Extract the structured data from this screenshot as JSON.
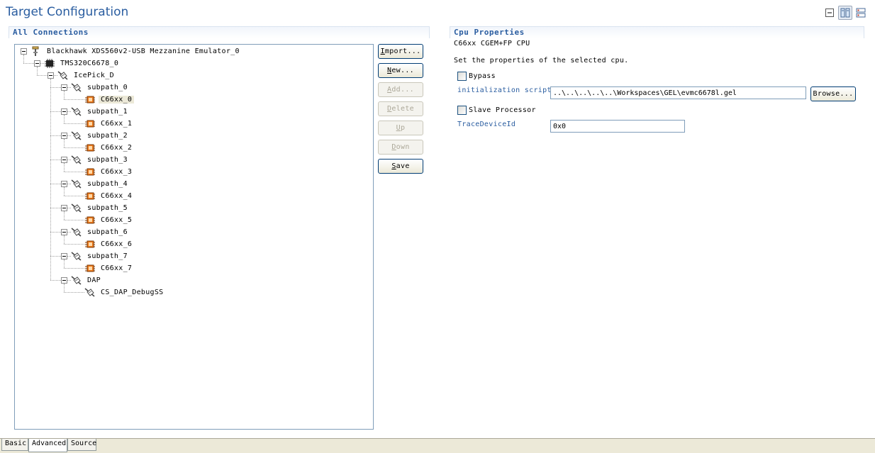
{
  "page": {
    "title": "Target Configuration"
  },
  "left_section": {
    "title": "All Connections"
  },
  "tree": [
    {
      "label": "Blackhawk XDS560v2-USB Mezzanine Emulator_0",
      "icon": "emulator-icon",
      "depth": 0,
      "expandable": true,
      "selected": false
    },
    {
      "label": "TMS320C6678_0",
      "icon": "chip-icon",
      "depth": 1,
      "expandable": true,
      "selected": false
    },
    {
      "label": "IcePick_D",
      "icon": "router-icon",
      "depth": 2,
      "expandable": true,
      "selected": false
    },
    {
      "label": "subpath_0",
      "icon": "router-icon",
      "depth": 3,
      "expandable": true,
      "selected": false
    },
    {
      "label": "C66xx_0",
      "icon": "cpu-icon",
      "depth": 4,
      "expandable": false,
      "selected": true
    },
    {
      "label": "subpath_1",
      "icon": "router-icon",
      "depth": 3,
      "expandable": true,
      "selected": false
    },
    {
      "label": "C66xx_1",
      "icon": "cpu-icon",
      "depth": 4,
      "expandable": false,
      "selected": false
    },
    {
      "label": "subpath_2",
      "icon": "router-icon",
      "depth": 3,
      "expandable": true,
      "selected": false
    },
    {
      "label": "C66xx_2",
      "icon": "cpu-icon",
      "depth": 4,
      "expandable": false,
      "selected": false
    },
    {
      "label": "subpath_3",
      "icon": "router-icon",
      "depth": 3,
      "expandable": true,
      "selected": false
    },
    {
      "label": "C66xx_3",
      "icon": "cpu-icon",
      "depth": 4,
      "expandable": false,
      "selected": false
    },
    {
      "label": "subpath_4",
      "icon": "router-icon",
      "depth": 3,
      "expandable": true,
      "selected": false
    },
    {
      "label": "C66xx_4",
      "icon": "cpu-icon",
      "depth": 4,
      "expandable": false,
      "selected": false
    },
    {
      "label": "subpath_5",
      "icon": "router-icon",
      "depth": 3,
      "expandable": true,
      "selected": false
    },
    {
      "label": "C66xx_5",
      "icon": "cpu-icon",
      "depth": 4,
      "expandable": false,
      "selected": false
    },
    {
      "label": "subpath_6",
      "icon": "router-icon",
      "depth": 3,
      "expandable": true,
      "selected": false
    },
    {
      "label": "C66xx_6",
      "icon": "cpu-icon",
      "depth": 4,
      "expandable": false,
      "selected": false
    },
    {
      "label": "subpath_7",
      "icon": "router-icon",
      "depth": 3,
      "expandable": true,
      "selected": false
    },
    {
      "label": "C66xx_7",
      "icon": "cpu-icon",
      "depth": 4,
      "expandable": false,
      "selected": false
    },
    {
      "label": "DAP",
      "icon": "router-icon",
      "depth": 3,
      "expandable": true,
      "selected": false
    },
    {
      "label": "CS_DAP_DebugSS",
      "icon": "router-icon",
      "depth": 4,
      "expandable": false,
      "selected": false
    }
  ],
  "buttons": [
    {
      "label": "Import...",
      "mnemonic": "I",
      "enabled": true
    },
    {
      "label": "New...",
      "mnemonic": "N",
      "enabled": true
    },
    {
      "label": "Add...",
      "mnemonic": "A",
      "enabled": false
    },
    {
      "label": "Delete",
      "mnemonic": "D",
      "enabled": false
    },
    {
      "label": "Up",
      "mnemonic": "U",
      "enabled": false
    },
    {
      "label": "Down",
      "mnemonic": "D",
      "enabled": false
    },
    {
      "label": "Save",
      "mnemonic": "S",
      "enabled": true
    }
  ],
  "right_section": {
    "title": "Cpu Properties",
    "cpu_name": "C66xx CGEM+FP CPU",
    "description": "Set the properties of the selected cpu.",
    "bypass_label": "Bypass",
    "bypass_checked": false,
    "init_script_label": "initialization script",
    "init_script_value": "..\\..\\..\\..\\..\\Workspaces\\GEL\\evmc6678l.gel",
    "browse_label": "Browse...",
    "slave_processor_label": "Slave Processor",
    "slave_processor_checked": false,
    "trace_device_label": "TraceDeviceId",
    "trace_device_value": "0x0"
  },
  "tabs": [
    {
      "label": "Basic",
      "active": false
    },
    {
      "label": "Advanced",
      "active": true
    },
    {
      "label": "Source",
      "active": false
    }
  ],
  "colors": {
    "accent": "#2a5da0",
    "cpu_orange": "#f07a1a",
    "border": "#7f9db9"
  }
}
